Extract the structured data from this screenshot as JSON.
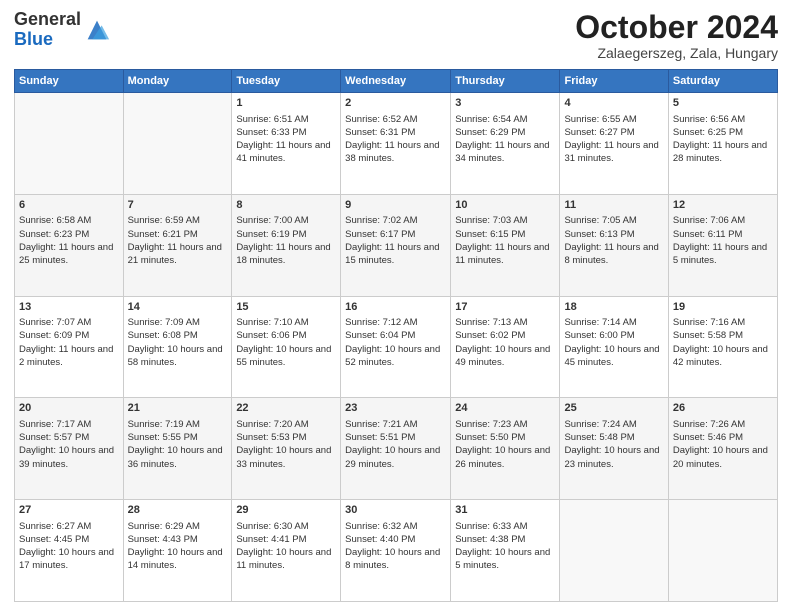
{
  "logo": {
    "general": "General",
    "blue": "Blue"
  },
  "title": "October 2024",
  "location": "Zalaegerszeg, Zala, Hungary",
  "days_of_week": [
    "Sunday",
    "Monday",
    "Tuesday",
    "Wednesday",
    "Thursday",
    "Friday",
    "Saturday"
  ],
  "weeks": [
    [
      {
        "day": "",
        "sunrise": "",
        "sunset": "",
        "daylight": ""
      },
      {
        "day": "",
        "sunrise": "",
        "sunset": "",
        "daylight": ""
      },
      {
        "day": "1",
        "sunrise": "Sunrise: 6:51 AM",
        "sunset": "Sunset: 6:33 PM",
        "daylight": "Daylight: 11 hours and 41 minutes."
      },
      {
        "day": "2",
        "sunrise": "Sunrise: 6:52 AM",
        "sunset": "Sunset: 6:31 PM",
        "daylight": "Daylight: 11 hours and 38 minutes."
      },
      {
        "day": "3",
        "sunrise": "Sunrise: 6:54 AM",
        "sunset": "Sunset: 6:29 PM",
        "daylight": "Daylight: 11 hours and 34 minutes."
      },
      {
        "day": "4",
        "sunrise": "Sunrise: 6:55 AM",
        "sunset": "Sunset: 6:27 PM",
        "daylight": "Daylight: 11 hours and 31 minutes."
      },
      {
        "day": "5",
        "sunrise": "Sunrise: 6:56 AM",
        "sunset": "Sunset: 6:25 PM",
        "daylight": "Daylight: 11 hours and 28 minutes."
      }
    ],
    [
      {
        "day": "6",
        "sunrise": "Sunrise: 6:58 AM",
        "sunset": "Sunset: 6:23 PM",
        "daylight": "Daylight: 11 hours and 25 minutes."
      },
      {
        "day": "7",
        "sunrise": "Sunrise: 6:59 AM",
        "sunset": "Sunset: 6:21 PM",
        "daylight": "Daylight: 11 hours and 21 minutes."
      },
      {
        "day": "8",
        "sunrise": "Sunrise: 7:00 AM",
        "sunset": "Sunset: 6:19 PM",
        "daylight": "Daylight: 11 hours and 18 minutes."
      },
      {
        "day": "9",
        "sunrise": "Sunrise: 7:02 AM",
        "sunset": "Sunset: 6:17 PM",
        "daylight": "Daylight: 11 hours and 15 minutes."
      },
      {
        "day": "10",
        "sunrise": "Sunrise: 7:03 AM",
        "sunset": "Sunset: 6:15 PM",
        "daylight": "Daylight: 11 hours and 11 minutes."
      },
      {
        "day": "11",
        "sunrise": "Sunrise: 7:05 AM",
        "sunset": "Sunset: 6:13 PM",
        "daylight": "Daylight: 11 hours and 8 minutes."
      },
      {
        "day": "12",
        "sunrise": "Sunrise: 7:06 AM",
        "sunset": "Sunset: 6:11 PM",
        "daylight": "Daylight: 11 hours and 5 minutes."
      }
    ],
    [
      {
        "day": "13",
        "sunrise": "Sunrise: 7:07 AM",
        "sunset": "Sunset: 6:09 PM",
        "daylight": "Daylight: 11 hours and 2 minutes."
      },
      {
        "day": "14",
        "sunrise": "Sunrise: 7:09 AM",
        "sunset": "Sunset: 6:08 PM",
        "daylight": "Daylight: 10 hours and 58 minutes."
      },
      {
        "day": "15",
        "sunrise": "Sunrise: 7:10 AM",
        "sunset": "Sunset: 6:06 PM",
        "daylight": "Daylight: 10 hours and 55 minutes."
      },
      {
        "day": "16",
        "sunrise": "Sunrise: 7:12 AM",
        "sunset": "Sunset: 6:04 PM",
        "daylight": "Daylight: 10 hours and 52 minutes."
      },
      {
        "day": "17",
        "sunrise": "Sunrise: 7:13 AM",
        "sunset": "Sunset: 6:02 PM",
        "daylight": "Daylight: 10 hours and 49 minutes."
      },
      {
        "day": "18",
        "sunrise": "Sunrise: 7:14 AM",
        "sunset": "Sunset: 6:00 PM",
        "daylight": "Daylight: 10 hours and 45 minutes."
      },
      {
        "day": "19",
        "sunrise": "Sunrise: 7:16 AM",
        "sunset": "Sunset: 5:58 PM",
        "daylight": "Daylight: 10 hours and 42 minutes."
      }
    ],
    [
      {
        "day": "20",
        "sunrise": "Sunrise: 7:17 AM",
        "sunset": "Sunset: 5:57 PM",
        "daylight": "Daylight: 10 hours and 39 minutes."
      },
      {
        "day": "21",
        "sunrise": "Sunrise: 7:19 AM",
        "sunset": "Sunset: 5:55 PM",
        "daylight": "Daylight: 10 hours and 36 minutes."
      },
      {
        "day": "22",
        "sunrise": "Sunrise: 7:20 AM",
        "sunset": "Sunset: 5:53 PM",
        "daylight": "Daylight: 10 hours and 33 minutes."
      },
      {
        "day": "23",
        "sunrise": "Sunrise: 7:21 AM",
        "sunset": "Sunset: 5:51 PM",
        "daylight": "Daylight: 10 hours and 29 minutes."
      },
      {
        "day": "24",
        "sunrise": "Sunrise: 7:23 AM",
        "sunset": "Sunset: 5:50 PM",
        "daylight": "Daylight: 10 hours and 26 minutes."
      },
      {
        "day": "25",
        "sunrise": "Sunrise: 7:24 AM",
        "sunset": "Sunset: 5:48 PM",
        "daylight": "Daylight: 10 hours and 23 minutes."
      },
      {
        "day": "26",
        "sunrise": "Sunrise: 7:26 AM",
        "sunset": "Sunset: 5:46 PM",
        "daylight": "Daylight: 10 hours and 20 minutes."
      }
    ],
    [
      {
        "day": "27",
        "sunrise": "Sunrise: 6:27 AM",
        "sunset": "Sunset: 4:45 PM",
        "daylight": "Daylight: 10 hours and 17 minutes."
      },
      {
        "day": "28",
        "sunrise": "Sunrise: 6:29 AM",
        "sunset": "Sunset: 4:43 PM",
        "daylight": "Daylight: 10 hours and 14 minutes."
      },
      {
        "day": "29",
        "sunrise": "Sunrise: 6:30 AM",
        "sunset": "Sunset: 4:41 PM",
        "daylight": "Daylight: 10 hours and 11 minutes."
      },
      {
        "day": "30",
        "sunrise": "Sunrise: 6:32 AM",
        "sunset": "Sunset: 4:40 PM",
        "daylight": "Daylight: 10 hours and 8 minutes."
      },
      {
        "day": "31",
        "sunrise": "Sunrise: 6:33 AM",
        "sunset": "Sunset: 4:38 PM",
        "daylight": "Daylight: 10 hours and 5 minutes."
      },
      {
        "day": "",
        "sunrise": "",
        "sunset": "",
        "daylight": ""
      },
      {
        "day": "",
        "sunrise": "",
        "sunset": "",
        "daylight": ""
      }
    ]
  ]
}
